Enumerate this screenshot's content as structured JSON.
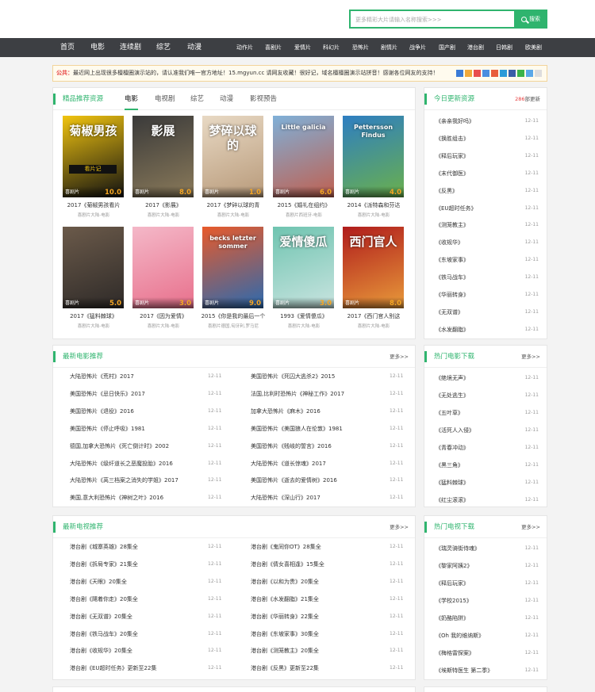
{
  "search": {
    "placeholder": "更多精彩大片请输入名称搜索>>>",
    "button": "搜索"
  },
  "nav": {
    "main": [
      "首页",
      "电影",
      "连续剧",
      "综艺",
      "动漫"
    ],
    "sub": [
      "动作片",
      "喜剧片",
      "爱情片",
      "科幻片",
      "恐怖片",
      "剧情片",
      "战争片",
      "国产剧",
      "港台剧",
      "日韩剧",
      "欧美剧"
    ]
  },
  "notice": {
    "label": "公共：",
    "text": "最近网上出现很多檀檀圈演示站的，请认准我们唯一官方地址！15.mgyun.cc 请网友收藏！很好记，域名檀檀圈演示站拼音！感谢各位网友的支持！"
  },
  "featured": {
    "title": "精品推荐资源",
    "tabs": [
      "电影",
      "电视剧",
      "综艺",
      "动漫",
      "影视预告"
    ],
    "items": [
      {
        "title": "2017《菊椒男孩看片",
        "sub": "喜剧片大陆-电影",
        "tag": "喜剧片",
        "score": "10.0",
        "poster_text": "菊椒男孩",
        "poster_band": "看片记",
        "color1": "#f1c40f",
        "color2": "#111111"
      },
      {
        "title": "2017《影展》",
        "sub": "喜剧片大陆-电影",
        "tag": "喜剧片",
        "score": "8.0",
        "poster_text": "影展",
        "color1": "#3a3a3a",
        "color2": "#8a7a5a"
      },
      {
        "title": "2017《梦碎以球的青",
        "sub": "喜剧片大陆-电影",
        "tag": "喜剧片",
        "score": "1.0",
        "poster_text": "梦碎以球的",
        "color1": "#e8d9c4",
        "color2": "#b89a7a"
      },
      {
        "title": "2015《婚礼在组约》",
        "sub": "喜剧片西班牙-电影",
        "tag": "喜剧片",
        "score": "6.0",
        "poster_text": "Little galicia",
        "color1": "#7fb0d8",
        "color2": "#c06050"
      },
      {
        "title": "2014《派特森和芬达",
        "sub": "喜剧片大陆-电影",
        "tag": "喜剧片",
        "score": "4.0",
        "poster_text": "Pettersson Findus",
        "color1": "#2e7ec2",
        "color2": "#6ab04c"
      },
      {
        "title": "2017《猛料棘球》",
        "sub": "喜剧片大陆-电影",
        "tag": "喜剧片",
        "score": "5.0",
        "poster_text": "",
        "color1": "#6b5a4a",
        "color2": "#2e2a28"
      },
      {
        "title": "2017《因为爱情》",
        "sub": "喜剧片大陆-电影",
        "tag": "喜剧片",
        "score": "3.0",
        "poster_text": "",
        "color1": "#f4b8c8",
        "color2": "#e8708c"
      },
      {
        "title": "2015《你是我的最后一个",
        "sub": "喜剧片德国,匈牙利,罗马尼",
        "tag": "喜剧片",
        "score": "9.0",
        "poster_text": "becks letzter sommer",
        "color1": "#e85a2a",
        "color2": "#2a6ab0"
      },
      {
        "title": "1993《爱情傻瓜》",
        "sub": "喜剧片大陆-电影",
        "tag": "喜剧片",
        "score": "3.0",
        "poster_text": "爱情傻瓜",
        "color1": "#6fc4b0",
        "color2": "#c9e4e0"
      },
      {
        "title": "2017《西门官人别这",
        "sub": "喜剧片大陆-电影",
        "tag": "喜剧片",
        "score": "8.0",
        "poster_text": "西门官人",
        "color1": "#b01c1c",
        "color2": "#e89a3a"
      }
    ]
  },
  "today": {
    "title": "今日更新资源",
    "count": "286",
    "count_label": "部更新",
    "items": [
      {
        "name": "《亲亲我好吗》",
        "date": "12-11"
      },
      {
        "name": "《换胜组击》",
        "date": "12-11"
      },
      {
        "name": "《释后玩家》",
        "date": "12-11"
      },
      {
        "name": "《末代御医》",
        "date": "12-11"
      },
      {
        "name": "《反黑》",
        "date": "12-11"
      },
      {
        "name": "《EU超时任务》",
        "date": "12-11"
      },
      {
        "name": "《测笼教主》",
        "date": "12-11"
      },
      {
        "name": "《收规华》",
        "date": "12-11"
      },
      {
        "name": "《东坡家事》",
        "date": "12-11"
      },
      {
        "name": "《铁马战车》",
        "date": "12-11"
      },
      {
        "name": "《华丽转身》",
        "date": "12-11"
      },
      {
        "name": "《无双谱》",
        "date": "12-11"
      },
      {
        "name": "《水发翻脂》",
        "date": "12-11"
      }
    ]
  },
  "movies": {
    "title": "最新电影推荐",
    "more": "更多>>",
    "left": [
      {
        "name": "大陆恐怖片《荒村》2017",
        "date": "12-11"
      },
      {
        "name": "美国恐怖片《忌日快乐》2017",
        "date": "12-11"
      },
      {
        "name": "美国恐怖片《退役》2016",
        "date": "12-11"
      },
      {
        "name": "美国恐怖片《停止呼吸》1981",
        "date": "12-11"
      },
      {
        "name": "德国,加拿大恐怖片《死亡倒计时》2002",
        "date": "12-11"
      },
      {
        "name": "大陆恐怖片《级纤道长之恶魔投胎》2016",
        "date": "12-11"
      },
      {
        "name": "大陆恐怖片《莴三档案之消失的学姐》2017",
        "date": "12-11"
      },
      {
        "name": "美国,意大利恐怖片《神树之叶》2016",
        "date": "12-11"
      }
    ],
    "right": [
      {
        "name": "美国恐怖片《死囚大逃杀2》2015",
        "date": "12-11"
      },
      {
        "name": "法国,比利时恐怖片《神秘工作》2017",
        "date": "12-11"
      },
      {
        "name": "加拿大恐怖片《麻木》2016",
        "date": "12-11"
      },
      {
        "name": "美国恐怖片《美国狼人在伦敦》1981",
        "date": "12-11"
      },
      {
        "name": "美国恐怖片《贱岐的誓言》2016",
        "date": "12-11"
      },
      {
        "name": "大陆恐怖片《道长惊魂》2017",
        "date": "12-11"
      },
      {
        "name": "美国恐怖片《逝去的爱情树》2016",
        "date": "12-11"
      },
      {
        "name": "大陆恐怖片《深山行》2017",
        "date": "12-11"
      }
    ]
  },
  "hot_movies": {
    "title": "热门电影下载",
    "more": "更多>>",
    "items": [
      {
        "name": "《绝境无声》",
        "date": "12-11"
      },
      {
        "name": "《无处逃生》",
        "date": "12-11"
      },
      {
        "name": "《五叶草》",
        "date": "12-11"
      },
      {
        "name": "《活死人入侵》",
        "date": "12-11"
      },
      {
        "name": "《青春冲动》",
        "date": "12-11"
      },
      {
        "name": "《黑三角》",
        "date": "12-11"
      },
      {
        "name": "《猛料棘球》",
        "date": "12-11"
      },
      {
        "name": "《红尘滚滚》",
        "date": "12-11"
      }
    ]
  },
  "tv": {
    "title": "最新电视推荐",
    "more": "更多>>",
    "left": [
      {
        "name": "港台剧《城寨英雄》28集全",
        "date": "12-11"
      },
      {
        "name": "港台剧《拆局专家》21集全",
        "date": "12-11"
      },
      {
        "name": "港台剧《天眼》20集全",
        "date": "12-11"
      },
      {
        "name": "港台剧《飓着你走》20集全",
        "date": "12-11"
      },
      {
        "name": "港台剧《无双谱》20集全",
        "date": "12-11"
      },
      {
        "name": "港台剧《铁马战车》20集全",
        "date": "12-11"
      },
      {
        "name": "港台剧《收规华》20集全",
        "date": "12-11"
      },
      {
        "name": "港台剧《EU超时任务》更新至22集",
        "date": "12-11"
      }
    ],
    "right": [
      {
        "name": "港台剧《鬼同你OT》28集全",
        "date": "12-11"
      },
      {
        "name": "港台剧《倩女喜相逢》15集全",
        "date": "12-11"
      },
      {
        "name": "港台剧《以和为贵》20集全",
        "date": "12-11"
      },
      {
        "name": "港台剧《水发翻脂》21集全",
        "date": "12-11"
      },
      {
        "name": "港台剧《华丽转身》22集全",
        "date": "12-11"
      },
      {
        "name": "港台剧《东坡家事》30集全",
        "date": "12-11"
      },
      {
        "name": "港台剧《测笼教主》20集全",
        "date": "12-11"
      },
      {
        "name": "港台剧《反黑》更新至22集",
        "date": "12-11"
      }
    ]
  },
  "hot_tv": {
    "title": "热门电视下载",
    "more": "更多>>",
    "items": [
      {
        "name": "《瑞灵骑街侍魂》",
        "date": "12-11"
      },
      {
        "name": "《黎家阿姨2》",
        "date": "12-11"
      },
      {
        "name": "《释后玩家》",
        "date": "12-11"
      },
      {
        "name": "《学校2015》",
        "date": "12-11"
      },
      {
        "name": "《奶酪陷阱》",
        "date": "12-11"
      },
      {
        "name": "《Oh 我的维纳斯》",
        "date": "12-11"
      },
      {
        "name": "《梅格雷探案》",
        "date": "12-11"
      },
      {
        "name": "《埃斯特医生 第二季》",
        "date": "12-11"
      }
    ]
  },
  "colors": {
    "accent": "#2fb46e",
    "nav": "#3d3f43",
    "notice_border": "#f2d49a",
    "notice_red": "#e63c3c",
    "score": "#f5a623"
  }
}
